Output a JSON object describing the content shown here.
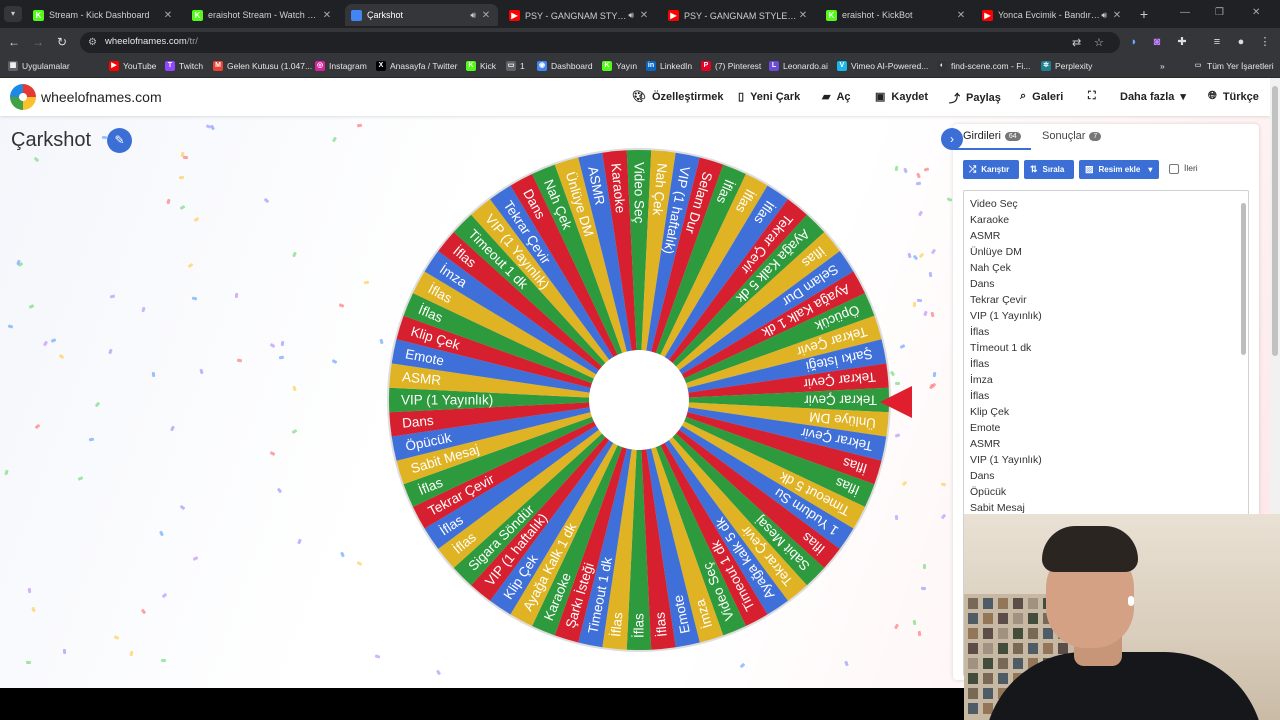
{
  "browser": {
    "tabs": [
      {
        "title": "Stream - Kick Dashboard",
        "fav": "K",
        "fav_color": "#53fc18",
        "active": false,
        "audio": false
      },
      {
        "title": "eraishot Stream - Watch Live on",
        "fav": "K",
        "fav_color": "#53fc18",
        "active": false,
        "audio": false
      },
      {
        "title": "Çarkshot",
        "fav": "",
        "fav_color": "#4285f4",
        "active": true,
        "audio": true
      },
      {
        "title": "PSY - GANGNAM STYLE(강남스",
        "fav": "▶",
        "fav_color": "#ff0000",
        "active": false,
        "audio": true
      },
      {
        "title": "PSY - GANGNAM STYLE(강남스",
        "fav": "▶",
        "fav_color": "#ff0000",
        "active": false,
        "audio": false
      },
      {
        "title": "eraishot - KickBot",
        "fav": "K",
        "fav_color": "#53fc18",
        "active": false,
        "audio": false
      },
      {
        "title": "Yonca Evcimik - Bandıra Bandıra",
        "fav": "▶",
        "fav_color": "#ff0000",
        "active": false,
        "audio": true
      }
    ],
    "url_host": "wheelofnames.com",
    "url_path": "/tr/",
    "bookmarks": [
      {
        "label": "Uygulamalar",
        "icon": "▦",
        "color": "#5f6368"
      },
      {
        "label": "YouTube",
        "icon": "▶",
        "color": "#ff0000"
      },
      {
        "label": "Twitch",
        "icon": "T",
        "color": "#9146ff"
      },
      {
        "label": "Gelen Kutusu (1.047...",
        "icon": "M",
        "color": "#ea4335"
      },
      {
        "label": "Instagram",
        "icon": "◎",
        "color": "#d6249f"
      },
      {
        "label": "Anasayfa / Twitter",
        "icon": "X",
        "color": "#000000"
      },
      {
        "label": "Kick",
        "icon": "K",
        "color": "#53fc18"
      },
      {
        "label": "1",
        "icon": "▭",
        "color": "#5f6368"
      },
      {
        "label": "Dashboard",
        "icon": "◉",
        "color": "#4285f4"
      },
      {
        "label": "Yayın",
        "icon": "K",
        "color": "#53fc18"
      },
      {
        "label": "LinkedIn",
        "icon": "in",
        "color": "#0a66c2"
      },
      {
        "label": "(7) Pinterest",
        "icon": "P",
        "color": "#e60023"
      },
      {
        "label": "Leonardo.ai",
        "icon": "L",
        "color": "#6b4bd8"
      },
      {
        "label": "Vimeo AI-Powered...",
        "icon": "V",
        "color": "#1ab7ea"
      },
      {
        "label": "find-scene.com - Fi...",
        "icon": "◐",
        "color": "#333333"
      },
      {
        "label": "Perplexity",
        "icon": "✲",
        "color": "#20808d"
      }
    ],
    "all_bookmarks_label": "Tüm Yer İşaretleri"
  },
  "site": {
    "name": "wheelofnames.com",
    "nav": {
      "customize": "Özelleştirmek",
      "new": "Yeni Çark",
      "open": "Aç",
      "save": "Kaydet",
      "share": "Paylaş",
      "gallery": "Galeri",
      "more": "Daha fazla",
      "language": "Türkçe"
    },
    "wheel_title": "Çarkshot"
  },
  "panel": {
    "entries_tab": "Girdileri",
    "entries_count": "64",
    "results_tab": "Sonuçlar",
    "results_count": "7",
    "shuffle": "Karıştır",
    "sort": "Sırala",
    "add_image": "Resim ekle",
    "advanced": "İleri",
    "entries": [
      "Video Seç",
      "Karaoke",
      "ASMR",
      "Ünlüye DM",
      "Nah Çek",
      "Dans",
      "Tekrar Çevir",
      "VIP (1 Yayınlık)",
      "İflas",
      "Tİmeout 1 dk",
      "İflas",
      "İmza",
      "İflas",
      "Klip Çek",
      "Emote",
      "ASMR",
      "VIP (1 Yayınlık)",
      "Dans",
      "Öpücük",
      "Sabit Mesaj"
    ]
  },
  "wheel": {
    "colors": [
      "#2e9a3e",
      "#e0b324",
      "#3f6fd8",
      "#d6202f"
    ],
    "segments": [
      "İflas",
      "İflas",
      "Timeout 1 dk",
      "Şarkı İsteği",
      "Karaoke",
      "Ayağa Kalk 1 dk",
      "Klip Çek",
      "VIP (1 haftalık)",
      "Sigara Söndür",
      "İflas",
      "İflas",
      "Tekrar Çevir",
      "İflas",
      "Sabit Mesaj",
      "Öpücük",
      "Dans",
      "VIP (1 Yayınlık)",
      "ASMR",
      "Emote",
      "Klip Çek",
      "İflas",
      "İflas",
      "İmza",
      "İflas",
      "Timeout 1 dk",
      "VIP (1 Yayınlık)",
      "Tekrar Çevir",
      "Dans",
      "Nah Çek",
      "Ünlüye DM",
      "ASMR",
      "Karaoke",
      "Video Seç",
      "Nah Çek",
      "VIP (1 haftalık)",
      "Selam Dur",
      "İflas",
      "İflas",
      "İflas",
      "Tekrar Çevir",
      "Ayağa Kalk 5 dk",
      "İflas",
      "Selam Dur",
      "Ayağa Kalk 1 dk",
      "Öpücük",
      "Tekrar Çevir",
      "Şarkı İsteği",
      "Tekrar Çevir",
      "Tekrar Çevir",
      "Ünlüye DM",
      "Tekrar Çevir",
      "İflas",
      "İflas",
      "Timeout 5 dk",
      "1 Yudum Su",
      "İflas",
      "Sabit Mesaj",
      "Tekrar Çevir",
      "Ayağa kalk 5 dk",
      "Timeout 1 dk",
      "Video Seç",
      "İmza",
      "Emote",
      "İflas"
    ]
  }
}
